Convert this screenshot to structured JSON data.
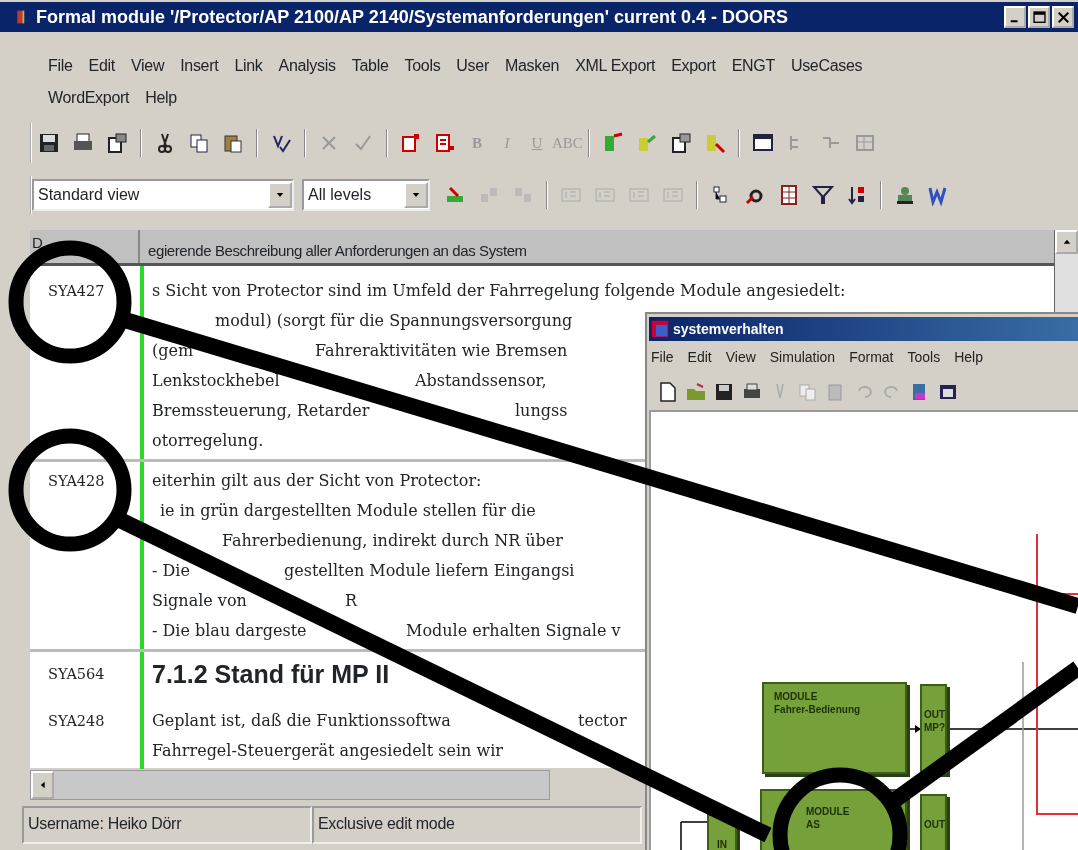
{
  "window": {
    "title": "Formal module '/Protector/AP 2100/AP 2140/Systemanforderungen' current 0.4 - DOORS"
  },
  "menu": [
    {
      "label": "File"
    },
    {
      "label": "Edit"
    },
    {
      "label": "View"
    },
    {
      "label": "Insert"
    },
    {
      "label": "Link"
    },
    {
      "label": "Analysis"
    },
    {
      "label": "Table"
    },
    {
      "label": "Tools"
    },
    {
      "label": "User"
    },
    {
      "label": "Masken"
    },
    {
      "label": "XML Export"
    },
    {
      "label": "Export"
    },
    {
      "label": "ENGT"
    },
    {
      "label": "UseCases"
    },
    {
      "label": "WordExport"
    },
    {
      "label": "Help"
    }
  ],
  "format_buttons": [
    {
      "label": "B",
      "disabled": true
    },
    {
      "label": "I",
      "disabled": true
    },
    {
      "label": "U",
      "disabled": true
    },
    {
      "label": "ABC",
      "disabled": true
    }
  ],
  "view_select": {
    "value": "Standard view"
  },
  "level_select": {
    "value": "All levels"
  },
  "table": {
    "columns": [
      "D",
      "egierende Beschreibung aller Anforderungen an das System"
    ],
    "rows": [
      {
        "id": "SYA427",
        "kind": "text",
        "lines": [
          [
            "s Sicht von Protector sind im Umfeld der Fahrregelung folgende Module angesiedelt:"
          ],
          [
            "modul) (sorgt für die Spannungsversorgung"
          ],
          [
            "(gem",
            "Fahreraktivitäten wie Bremsen"
          ],
          [
            "Lenkstockhebel",
            "Abstandssensor,"
          ],
          [
            "Bremssteuerung, Retarder",
            "lungss"
          ],
          [
            "otorregelung."
          ]
        ]
      },
      {
        "id": "SYA428",
        "kind": "text",
        "lines": [
          [
            "eiterhin gilt aus der Sicht von Protector:"
          ],
          [
            "ie in grün dargestellten Module stellen für die"
          ],
          [
            "Fahrerbedienung, indirekt durch NR über"
          ],
          [
            "- Die",
            "gestellten Module liefern Eingangsi"
          ],
          [
            "Signale von",
            "R"
          ],
          [
            "- Die blau dargeste",
            "Module erhalten Signale v"
          ]
        ]
      },
      {
        "id": "SYA564",
        "kind": "heading",
        "lines": [
          [
            "7.1.2 Stand für MP II"
          ]
        ]
      },
      {
        "id": "SYA248",
        "kind": "text",
        "lines": [
          [
            "Geplant ist, daß die Funktionssoftwa",
            "tector"
          ],
          [
            "Fahrregel-Steuergerät angesiedelt sein wir"
          ]
        ]
      }
    ]
  },
  "status_bar": [
    "Username: Heiko Dörr",
    "Exclusive edit mode"
  ],
  "sub_window": {
    "title": "systemverhalten",
    "menu": [
      {
        "label": "File"
      },
      {
        "label": "Edit"
      },
      {
        "label": "View"
      },
      {
        "label": "Simulation"
      },
      {
        "label": "Format"
      },
      {
        "label": "Tools"
      },
      {
        "label": "Help"
      }
    ],
    "blocks": [
      {
        "kind": "module",
        "lines": [
          "MODULE",
          "Fahrer-Bedienung"
        ]
      },
      {
        "kind": "port",
        "lines": [
          "OUT",
          "MP?"
        ]
      },
      {
        "kind": "module",
        "lines": [
          "MODULE",
          "AS"
        ]
      },
      {
        "kind": "port",
        "lines": [
          "IN"
        ]
      },
      {
        "kind": "port",
        "lines": [
          "OUT"
        ]
      }
    ]
  }
}
